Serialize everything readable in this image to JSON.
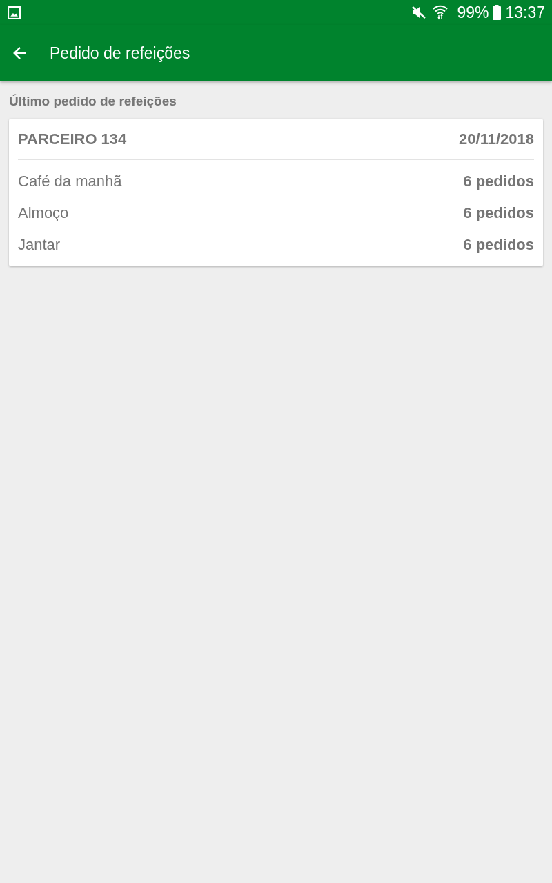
{
  "status_bar": {
    "battery": "99%",
    "time": "13:37"
  },
  "app_bar": {
    "title": "Pedido de refeições"
  },
  "section_title": "Último pedido de refeições",
  "order_card": {
    "partner": "PARCEIRO 134",
    "date": "20/11/2018",
    "meals": [
      {
        "name": "Café da manhã",
        "count": "6 pedidos"
      },
      {
        "name": "Almoço",
        "count": "6 pedidos"
      },
      {
        "name": "Jantar",
        "count": "6 pedidos"
      }
    ]
  }
}
